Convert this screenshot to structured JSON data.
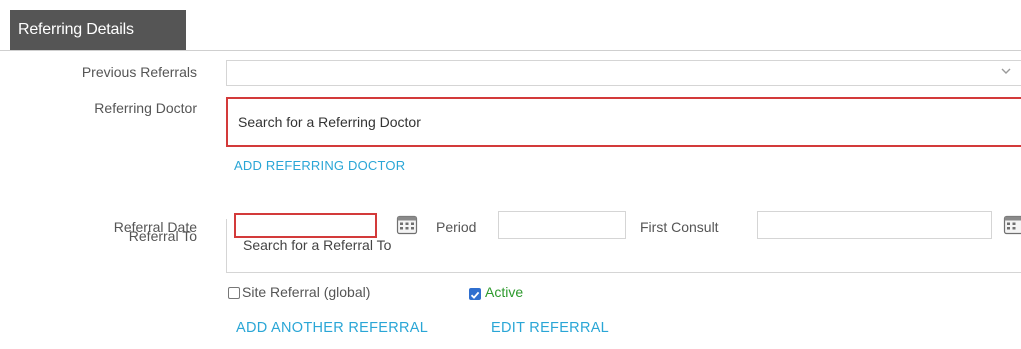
{
  "tab": {
    "label": "Referring Details"
  },
  "fields": {
    "previous_referrals": {
      "label": "Previous Referrals",
      "value": ""
    },
    "referring_doctor": {
      "label": "Referring Doctor",
      "placeholder": "Search for a Referring Doctor"
    },
    "add_referring_doctor": "ADD REFERRING DOCTOR",
    "referral_date": {
      "label": "Referral Date",
      "value": ""
    },
    "period": {
      "label": "Period",
      "value": ""
    },
    "first_consult": {
      "label": "First Consult",
      "value": ""
    },
    "referral_to": {
      "label": "Referral To",
      "placeholder": "Search for a Referral To"
    }
  },
  "checkboxes": {
    "site_referral": {
      "label": "Site Referral (global)",
      "checked": false
    },
    "active": {
      "label": "Active",
      "checked": true,
      "color": "#2e9a2e"
    }
  },
  "actions": {
    "add_another_referral": "ADD ANOTHER REFERRAL",
    "edit_referral": "EDIT REFERRAL"
  },
  "colors": {
    "accent_link": "#2aa6d6",
    "error_border": "#d33a3a",
    "tab_bg": "#555555",
    "checkbox_checked": "#2f6fcf"
  },
  "icons": [
    "chevron-down-icon",
    "calendar-icon"
  ]
}
